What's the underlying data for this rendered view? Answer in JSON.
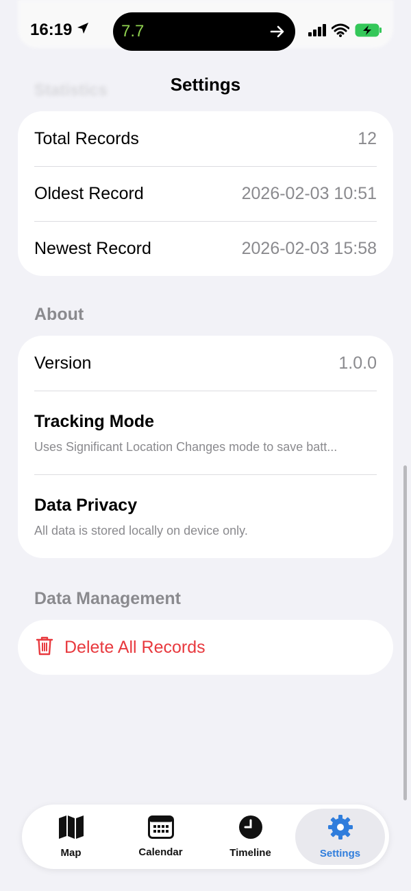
{
  "status_bar": {
    "time": "16:19",
    "activity_value": "7.7",
    "colors": {
      "activity": "#8fd14f",
      "battery": "#34c759"
    }
  },
  "nav": {
    "title": "Settings"
  },
  "background": {
    "ghost_header": "Statistics"
  },
  "statistics": {
    "rows": [
      {
        "label": "Total Records",
        "value": "12"
      },
      {
        "label": "Oldest Record",
        "value": "2026-02-03 10:51"
      },
      {
        "label": "Newest Record",
        "value": "2026-02-03 15:58"
      }
    ]
  },
  "about": {
    "header": "About",
    "version_label": "Version",
    "version_value": "1.0.0",
    "tracking_title": "Tracking Mode",
    "tracking_desc": "Uses Significant Location Changes mode to save batt...",
    "privacy_title": "Data Privacy",
    "privacy_desc": "All data is stored locally on device only."
  },
  "data_management": {
    "header": "Data Management",
    "delete_label": "Delete All Records",
    "delete_icon": "trash-icon",
    "color": "#e8393e"
  },
  "tab_bar": {
    "tabs": [
      {
        "label": "Map",
        "icon": "map-icon"
      },
      {
        "label": "Calendar",
        "icon": "calendar-icon"
      },
      {
        "label": "Timeline",
        "icon": "clock-icon"
      },
      {
        "label": "Settings",
        "icon": "gear-icon",
        "active": true
      }
    ],
    "accent": "#2f7ddc"
  }
}
